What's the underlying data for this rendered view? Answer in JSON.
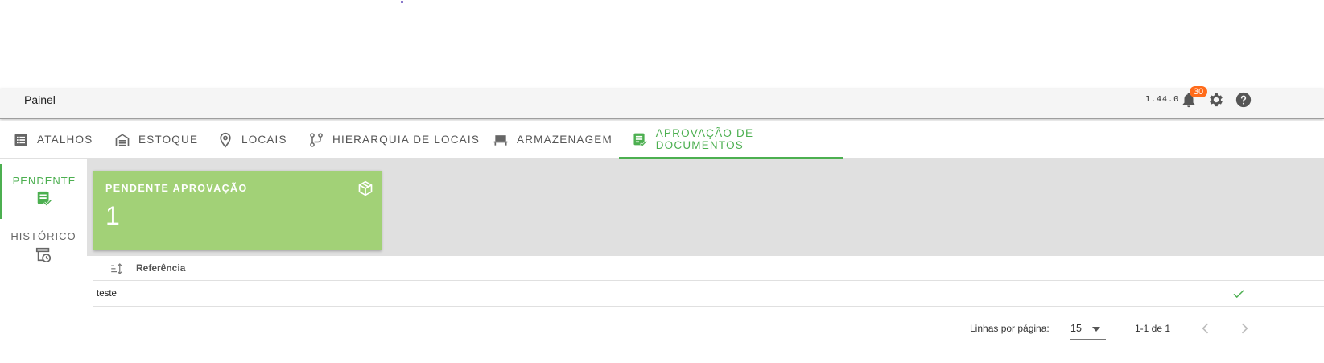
{
  "topbar": {
    "title": "Painel",
    "version": "1.44.0",
    "notification_count": "30"
  },
  "tabs": [
    {
      "label": "ATALHOS",
      "icon": "list-icon"
    },
    {
      "label": "ESTOQUE",
      "icon": "warehouse-icon"
    },
    {
      "label": "LOCAIS",
      "icon": "map-pin-icon"
    },
    {
      "label": "HIERARQUIA DE LOCAIS",
      "icon": "route-icon"
    },
    {
      "label": "ARMAZENAGEM",
      "icon": "shelf-icon"
    },
    {
      "label": "APROVAÇÃO DE DOCUMENTOS",
      "icon": "document-check-icon",
      "active": true
    }
  ],
  "sidenav": [
    {
      "label": "PENDENTE",
      "icon": "document-check-icon",
      "active": true
    },
    {
      "label": "HISTÓRICO",
      "icon": "history-icon"
    }
  ],
  "card": {
    "title": "PENDENTE APROVAÇÃO",
    "value": "1",
    "icon": "cube-icon"
  },
  "table": {
    "columns": [
      "Referência"
    ],
    "rows": [
      {
        "referencia": "teste"
      }
    ],
    "footer": {
      "rows_per_page_label": "Linhas por página:",
      "rows_per_page": "15",
      "range": "1-1 de 1"
    }
  },
  "colors": {
    "accent": "#4caf50",
    "card": "#a2d177",
    "badge": "#ff6b1a"
  }
}
